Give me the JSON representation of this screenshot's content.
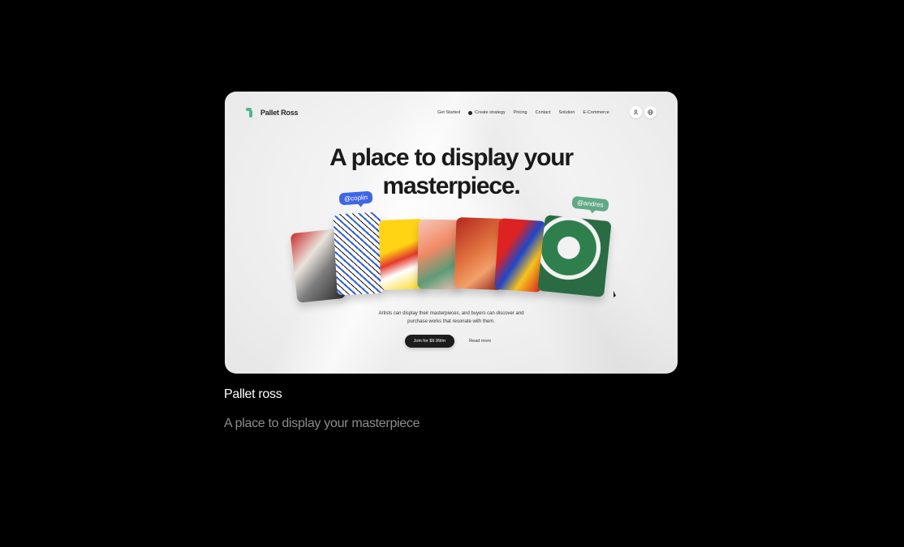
{
  "site": {
    "logo_text": "Pallet Ross",
    "menu": [
      "Get Started",
      "Create strategy",
      "Pricing",
      "Contact",
      "Solution",
      "E-Commerce"
    ],
    "icons": [
      "user-icon",
      "globe-icon"
    ],
    "hero_title_line1": "A place to display your",
    "hero_title_line2": "masterpiece.",
    "tags": [
      "@coplin",
      "@andres"
    ],
    "subtext_line1": "Artists can display their masterpieces, and buyers can discover and",
    "subtext_line2": "purchase works that resonate with them.",
    "cta_primary": "Join for $9.99/m",
    "cta_secondary": "Read more"
  },
  "caption": {
    "title": "Pallet ross",
    "subtitle": "A place to display your masterpiece"
  },
  "colors": {
    "background": "#000000",
    "brand_green": "#4fb58a",
    "tag_blue": "#3f66e6",
    "tag_green": "#5fa985"
  }
}
